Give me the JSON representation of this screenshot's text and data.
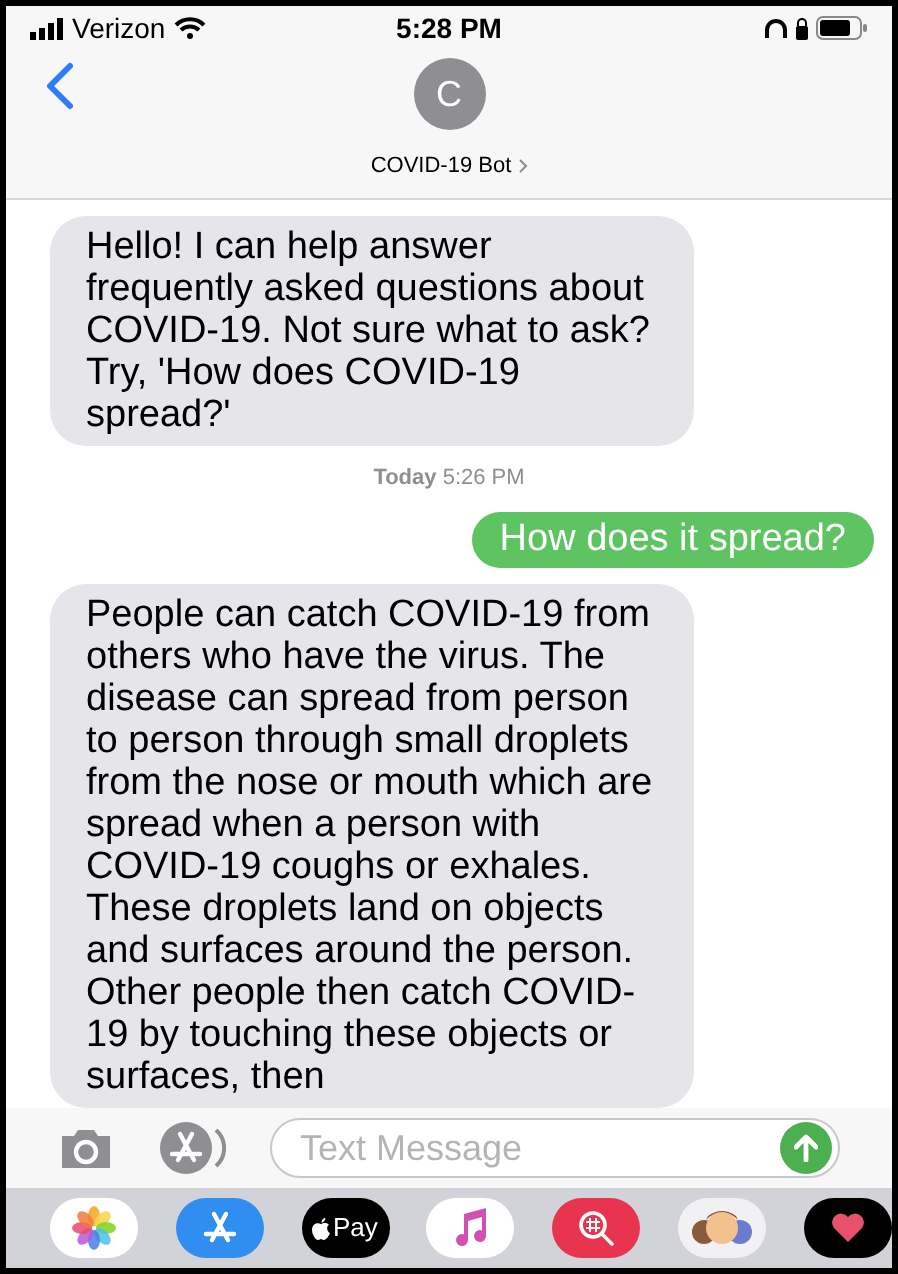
{
  "status_bar": {
    "carrier": "Verizon",
    "time": "5:28 PM"
  },
  "header": {
    "avatar_letter": "C",
    "contact": "COVID-19 Bot"
  },
  "messages": [
    {
      "kind": "received",
      "text": "Hello! I can help answer frequently asked questions about COVID-19. Not sure what to ask? Try, 'How does COVID-19 spread?'"
    },
    {
      "kind": "timestamp",
      "text": "**Today** 5:26 PM"
    },
    {
      "kind": "sent",
      "text": "How does it spread?"
    },
    {
      "kind": "received",
      "text": "People can catch COVID-19 from others who have the virus. The disease can spread from person to person through small droplets from the nose or mouth which are spread when a person with COVID-19 coughs or exhales. These droplets land on objects and surfaces around the person. Other people then catch COVID-19 by touching these objects or surfaces, then"
    }
  ],
  "composer": {
    "placeholder": "Text Message"
  },
  "app_tray": [
    {
      "kind": "photos"
    },
    {
      "kind": "store"
    },
    {
      "kind": "pay",
      "label": "Pay"
    },
    {
      "kind": "music"
    },
    {
      "kind": "search"
    },
    {
      "kind": "memoji"
    },
    {
      "kind": "heart"
    }
  ]
}
